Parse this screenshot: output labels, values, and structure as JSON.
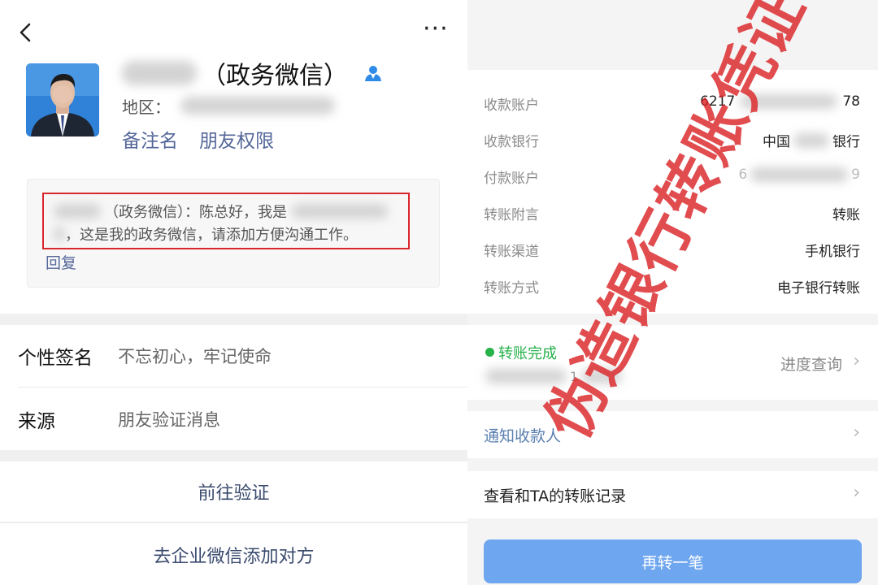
{
  "left_panel": {
    "name_suffix": "（政务微信）",
    "region_label": "地区：",
    "remark_label": "备注名",
    "permission_label": "朋友权限",
    "message": {
      "line1_text": "（政务微信）：陈总好，我是",
      "line2_text": "，这是我的政务微信，请添加方便沟通工作。",
      "reply_label": "回复"
    },
    "signature_label": "个性签名",
    "signature_value": "不忘初心，牢记使命",
    "source_label": "来源",
    "source_value": "朋友验证消息",
    "verify_button": "前往验证",
    "enterprise_button": "去企业微信添加对方",
    "icons": [
      "back-arrow-icon",
      "more-dots-icon",
      "contact-icon"
    ]
  },
  "right_panel": {
    "details": [
      {
        "label": "收款账户",
        "value_start": "6217",
        "value_end": "78"
      },
      {
        "label": "收款银行",
        "value_start": "中国",
        "value_end": "银行"
      },
      {
        "label": "付款账户",
        "value_start": "6",
        "value_end": "9"
      },
      {
        "label": "转账附言",
        "value": "转账"
      },
      {
        "label": "转账渠道",
        "value": "手机银行"
      },
      {
        "label": "转账方式",
        "value": "电子银行转账"
      }
    ],
    "status_text": "转账完成",
    "status_amount_partial": "1",
    "progress_link": "进度查询",
    "notify_label": "通知收款人",
    "record_label": "查看和TA的转账记录",
    "again_button": "再转一笔",
    "status_color": "#27b24a",
    "accent_color": "#6fa6f0"
  },
  "stamp_text": "伪造银行转账凭证",
  "stamp_color": "#da2428"
}
